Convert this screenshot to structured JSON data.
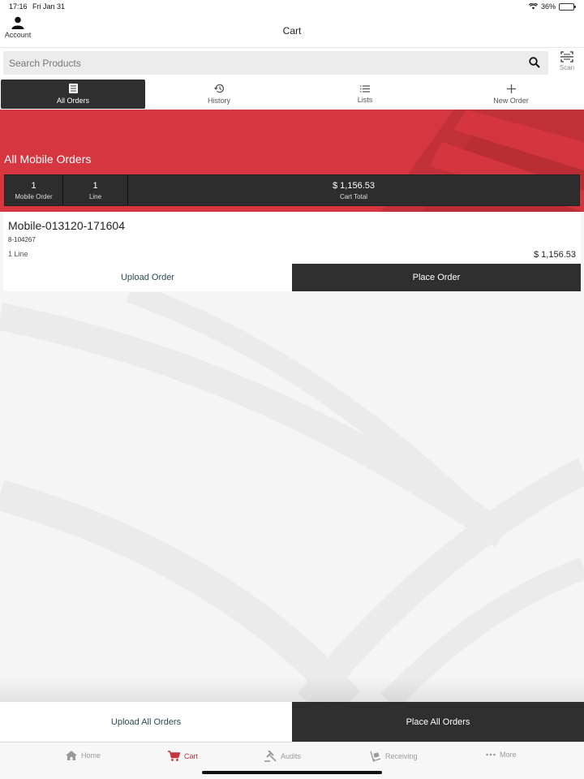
{
  "status": {
    "time": "17:16",
    "date": "Fri Jan 31",
    "battery": "36%"
  },
  "header": {
    "title": "Cart",
    "account_label": "Account"
  },
  "search": {
    "placeholder": "Search Products",
    "scan_label": "Scan"
  },
  "tabs": [
    {
      "label": "All Orders",
      "icon": "list-doc-icon"
    },
    {
      "label": "History",
      "icon": "history-icon"
    },
    {
      "label": "Lists",
      "icon": "lines-icon"
    },
    {
      "label": "New Order",
      "icon": "plus-icon"
    }
  ],
  "banner": {
    "title": "All Mobile Orders"
  },
  "stats": [
    {
      "value": "1",
      "label": "Mobile Order"
    },
    {
      "value": "1",
      "label": "Line"
    },
    {
      "value": "$ 1,156.53",
      "label": "Cart Total"
    }
  ],
  "order": {
    "name": "Mobile-013120-171604",
    "id": "8-104267",
    "lines": "1 Line",
    "total": "$ 1,156.53",
    "upload_label": "Upload Order",
    "place_label": "Place Order"
  },
  "bottom_actions": {
    "upload_all": "Upload All Orders",
    "place_all": "Place All Orders"
  },
  "nav": [
    {
      "label": "Home",
      "icon": "home-icon"
    },
    {
      "label": "Cart",
      "icon": "cart-icon"
    },
    {
      "label": "Audits",
      "icon": "gavel-icon"
    },
    {
      "label": "Receiving",
      "icon": "dolly-icon"
    },
    {
      "label": "More",
      "icon": "more-icon"
    }
  ],
  "colors": {
    "accent": "#d63640",
    "dark": "#2f2f2f",
    "active_nav": "#c8323b"
  }
}
